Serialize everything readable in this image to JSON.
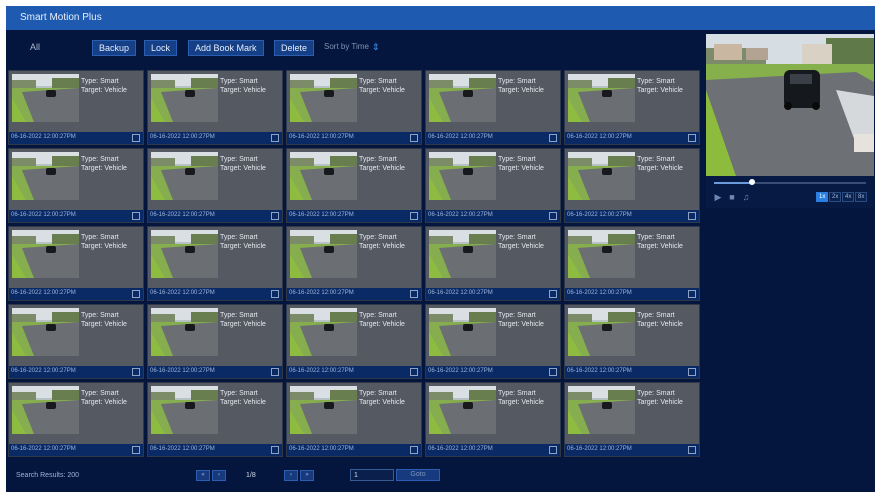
{
  "window": {
    "title": "Smart Motion Plus"
  },
  "toolbar": {
    "filter_all": "All",
    "backup": "Backup",
    "lock": "Lock",
    "add_bookmark": "Add Book Mark",
    "delete": "Delete",
    "sort_label": "Sort by Time"
  },
  "events": [
    {
      "type": "Type: Smart",
      "target": "Target: Vehicle",
      "timestamp": "06-16-2022 12:00:27PM"
    },
    {
      "type": "Type: Smart",
      "target": "Target: Vehicle",
      "timestamp": "06-16-2022 12:00:27PM"
    },
    {
      "type": "Type: Smart",
      "target": "Target: Vehicle",
      "timestamp": "06-16-2022 12:00:27PM"
    },
    {
      "type": "Type: Smart",
      "target": "Target: Vehicle",
      "timestamp": "06-16-2022 12:00:27PM"
    },
    {
      "type": "Type: Smart",
      "target": "Target: Vehicle",
      "timestamp": "06-16-2022 12:00:27PM"
    },
    {
      "type": "Type: Smart",
      "target": "Target: Vehicle",
      "timestamp": "06-16-2022 12:00:27PM"
    },
    {
      "type": "Type: Smart",
      "target": "Target: Vehicle",
      "timestamp": "06-16-2022 12:00:27PM"
    },
    {
      "type": "Type: Smart",
      "target": "Target: Vehicle",
      "timestamp": "06-16-2022 12:00:27PM"
    },
    {
      "type": "Type: Smart",
      "target": "Target: Vehicle",
      "timestamp": "06-16-2022 12:00:27PM"
    },
    {
      "type": "Type: Smart",
      "target": "Target: Vehicle",
      "timestamp": "06-16-2022 12:00:27PM"
    },
    {
      "type": "Type: Smart",
      "target": "Target: Vehicle",
      "timestamp": "06-16-2022 12:00:27PM"
    },
    {
      "type": "Type: Smart",
      "target": "Target: Vehicle",
      "timestamp": "06-16-2022 12:00:27PM"
    },
    {
      "type": "Type: Smart",
      "target": "Target: Vehicle",
      "timestamp": "06-16-2022 12:00:27PM"
    },
    {
      "type": "Type: Smart",
      "target": "Target: Vehicle",
      "timestamp": "06-16-2022 12:00:27PM"
    },
    {
      "type": "Type: Smart",
      "target": "Target: Vehicle",
      "timestamp": "06-16-2022 12:00:27PM"
    },
    {
      "type": "Type: Smart",
      "target": "Target: Vehicle",
      "timestamp": "06-16-2022 12:00:27PM"
    },
    {
      "type": "Type: Smart",
      "target": "Target: Vehicle",
      "timestamp": "06-16-2022 12:00:27PM"
    },
    {
      "type": "Type: Smart",
      "target": "Target: Vehicle",
      "timestamp": "06-16-2022 12:00:27PM"
    },
    {
      "type": "Type: Smart",
      "target": "Target: Vehicle",
      "timestamp": "06-16-2022 12:00:27PM"
    },
    {
      "type": "Type: Smart",
      "target": "Target: Vehicle",
      "timestamp": "06-16-2022 12:00:27PM"
    },
    {
      "type": "Type: Smart",
      "target": "Target: Vehicle",
      "timestamp": "06-16-2022 12:00:27PM"
    },
    {
      "type": "Type: Smart",
      "target": "Target: Vehicle",
      "timestamp": "06-16-2022 12:00:27PM"
    },
    {
      "type": "Type: Smart",
      "target": "Target: Vehicle",
      "timestamp": "06-16-2022 12:00:27PM"
    },
    {
      "type": "Type: Smart",
      "target": "Target: Vehicle",
      "timestamp": "06-16-2022 12:00:27PM"
    },
    {
      "type": "Type: Smart",
      "target": "Target: Vehicle",
      "timestamp": "06-16-2022 12:00:27PM"
    }
  ],
  "preview": {
    "playback_progress": 0.25,
    "speeds": [
      "1x",
      "2x",
      "4x",
      "8x"
    ],
    "active_speed": "1x"
  },
  "footer": {
    "results": "Search Results: 200",
    "page_label": "1/8",
    "goto_value": "1",
    "goto_button": "Goto"
  },
  "colors": {
    "title_bar": "#1e5bb0",
    "background": "#04163d",
    "button": "#153f86",
    "accent": "#2b7fe0",
    "cell": "#555962"
  }
}
